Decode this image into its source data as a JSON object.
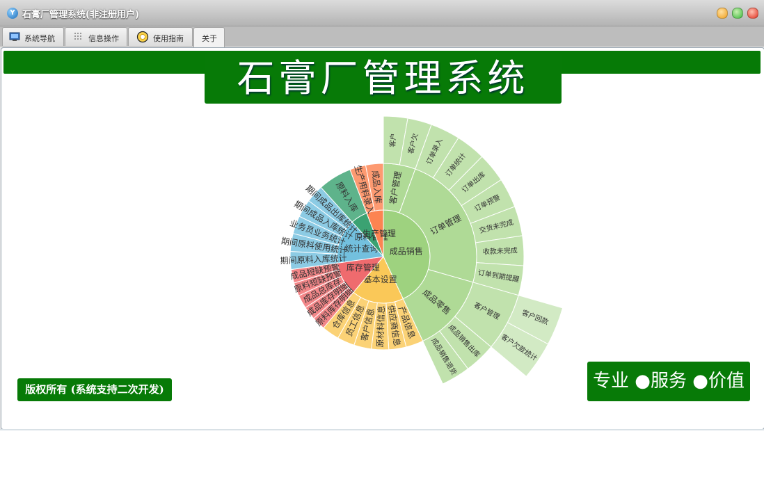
{
  "window": {
    "title": "石膏厂管理系统(非注册用户)",
    "app_icon": "y-logo-icon",
    "buttons": [
      {
        "name": "minimize-button",
        "color": "#f0a020"
      },
      {
        "name": "maximize-button",
        "color": "#3cb83c"
      },
      {
        "name": "close-button",
        "color": "#e03020"
      }
    ]
  },
  "tabs": [
    {
      "label": "系统导航",
      "icon": "monitor-icon"
    },
    {
      "label": "信息操作",
      "icon": "grid-icon"
    },
    {
      "label": "使用指南",
      "icon": "help-circle-icon"
    },
    {
      "label": "关于",
      "icon": "",
      "active": true
    }
  ],
  "banner": {
    "title": "石膏厂管理系统"
  },
  "footer": {
    "copyright": "版权所有 (系统支持二次开发)",
    "slogan": "专业 ●服务 ●价值"
  },
  "colors": {
    "brand_green": "#077a07",
    "sales": "#9ed27f",
    "inventory": "#ef6b6e",
    "basic": "#fac858",
    "stats": "#73c0de",
    "production": "#3ba272",
    "orange": "#fc8452"
  },
  "sunburst": {
    "root": [
      {
        "name": "成品销售",
        "color": "#9ed27f",
        "children": [
          {
            "name": "客户管理",
            "children": [
              {
                "name": "客户"
              },
              {
                "name": "客户欠"
              }
            ]
          },
          {
            "name": "订单管理",
            "children": [
              {
                "name": "订单录入"
              },
              {
                "name": "订单统计"
              },
              {
                "name": "订单出库"
              },
              {
                "name": "订单预警"
              },
              {
                "name": "交货未完成"
              },
              {
                "name": "收款未完成"
              },
              {
                "name": "订单到期提醒"
              }
            ]
          },
          {
            "name": "成品零售",
            "children": [
              {
                "name": "客户管理",
                "children": [
                  {
                    "name": "客户回款"
                  },
                  {
                    "name": "客户欠款统计"
                  }
                ]
              },
              {
                "name": "成品销售出库"
              },
              {
                "name": "成品销售退货"
              }
            ]
          }
        ]
      },
      {
        "name": "基本设置",
        "color": "#fac858",
        "children": [
          {
            "name": "产品信息"
          },
          {
            "name": "供应商信息"
          },
          {
            "name": "原材料信息"
          },
          {
            "name": "客户信息"
          },
          {
            "name": "员工信息"
          },
          {
            "name": "仓库信息"
          }
        ]
      },
      {
        "name": "库存管理",
        "color": "#ef6b6e",
        "children": [
          {
            "name": "原料库存明细"
          },
          {
            "name": "成品库存明细"
          },
          {
            "name": "成品总库存"
          },
          {
            "name": "原料短缺预警"
          },
          {
            "name": "成品短缺预警"
          }
        ]
      },
      {
        "name": "统计查询",
        "color": "#73c0de",
        "children": [
          {
            "name": "期间原料入库统计"
          },
          {
            "name": "期间原料使用统计"
          },
          {
            "name": "业务员业务统计"
          },
          {
            "name": "期间成品入库统计"
          },
          {
            "name": "期间成品出库统计"
          }
        ]
      },
      {
        "name": "原料管理",
        "color": "#3ba272",
        "children": [
          {
            "name": "原料入库"
          }
        ]
      },
      {
        "name": "生产管理",
        "color": "#fc8452",
        "children": [
          {
            "name": "生产用料录入"
          },
          {
            "name": "成品入库"
          }
        ]
      }
    ]
  }
}
